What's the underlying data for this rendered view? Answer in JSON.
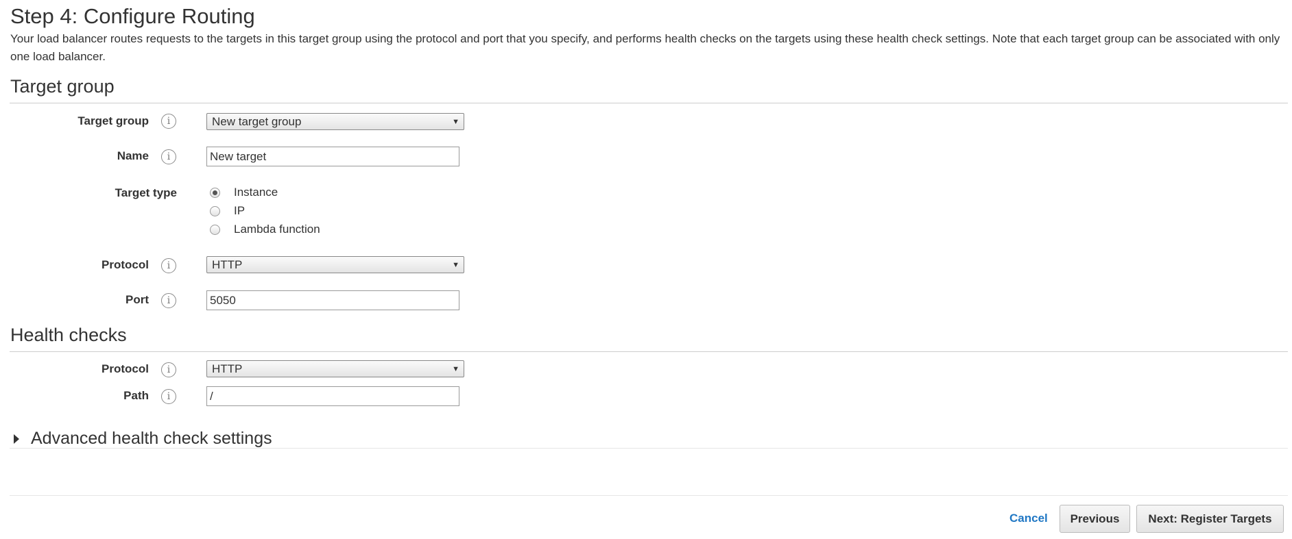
{
  "header": {
    "title": "Step 4: Configure Routing",
    "description": "Your load balancer routes requests to the targets in this target group using the protocol and port that you specify, and performs health checks on the targets using these health check settings. Note that each target group can be associated with only one load balancer."
  },
  "target_group": {
    "section_title": "Target group",
    "target_group_label": "Target group",
    "target_group_value": "New target group",
    "name_label": "Name",
    "name_value": "New target",
    "target_type_label": "Target type",
    "target_type_options": [
      {
        "label": "Instance",
        "checked": true
      },
      {
        "label": "IP",
        "checked": false
      },
      {
        "label": "Lambda function",
        "checked": false
      }
    ],
    "protocol_label": "Protocol",
    "protocol_value": "HTTP",
    "port_label": "Port",
    "port_value": "5050"
  },
  "health_checks": {
    "section_title": "Health checks",
    "protocol_label": "Protocol",
    "protocol_value": "HTTP",
    "path_label": "Path",
    "path_value": "/",
    "advanced_label": "Advanced health check settings"
  },
  "footer": {
    "cancel_label": "Cancel",
    "previous_label": "Previous",
    "next_label": "Next: Register Targets"
  },
  "icons": {
    "info": "info-icon",
    "dropdown": "chevron-down-icon",
    "expand": "triangle-right-icon"
  },
  "colors": {
    "link": "#1f77c4",
    "text": "#333333",
    "rule": "#cccccc"
  }
}
